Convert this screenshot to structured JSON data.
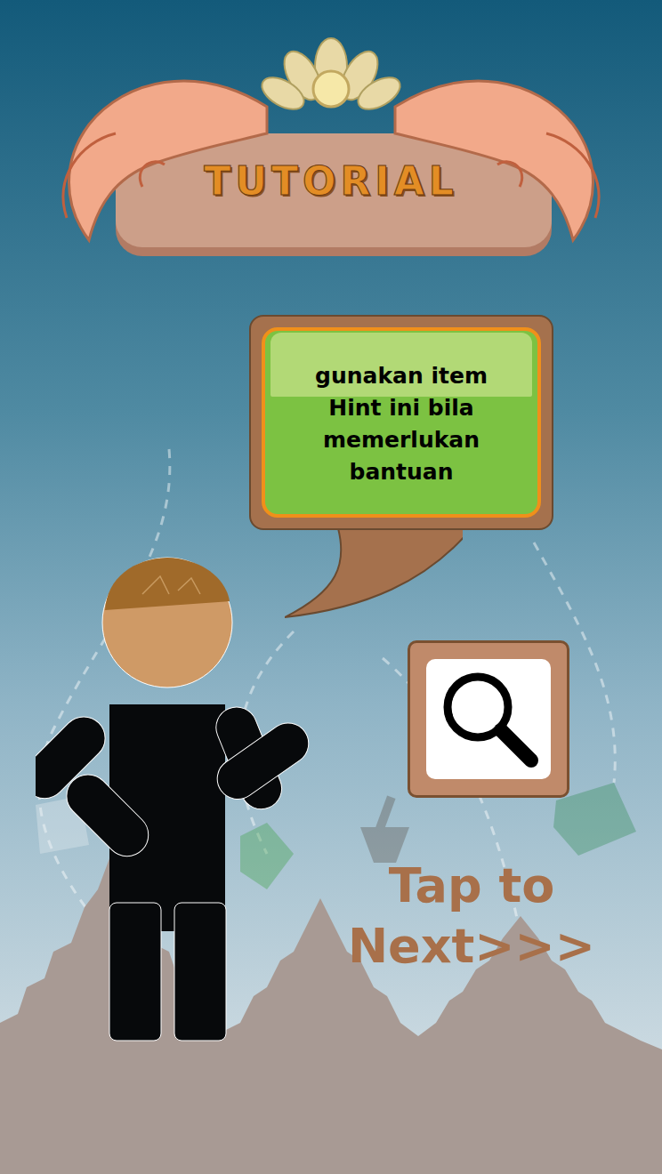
{
  "title": "TUTORIAL",
  "dialog": {
    "lines": [
      "gunakan item",
      "Hint ini bila",
      "memerlukan",
      "bantuan"
    ]
  },
  "tap_prompt": {
    "lines": [
      "Tap to",
      "Next>>>"
    ]
  }
}
